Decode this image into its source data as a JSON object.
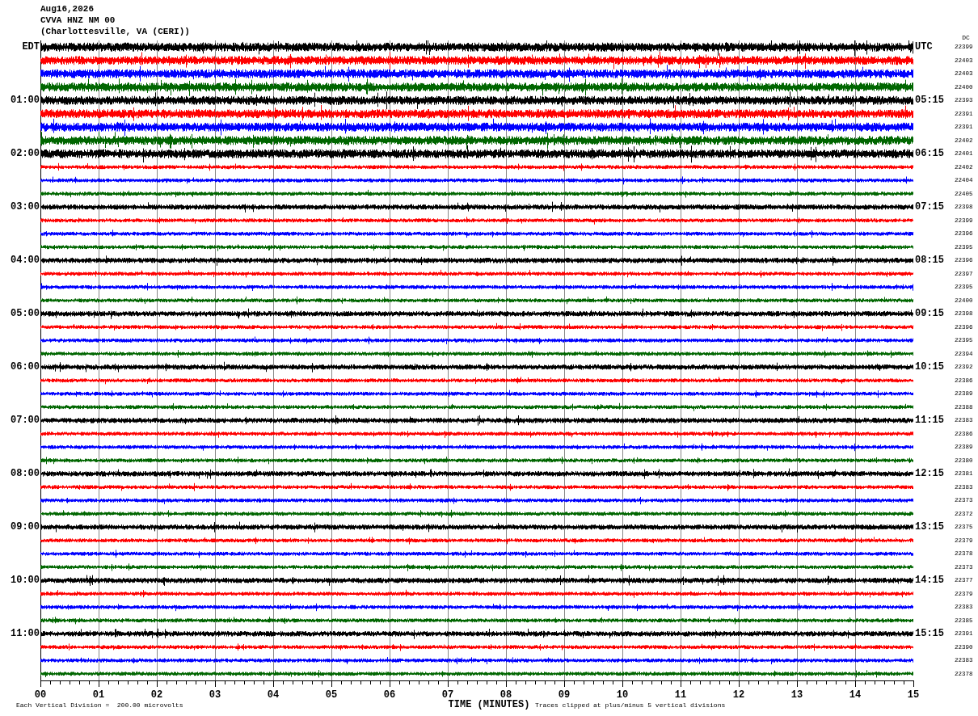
{
  "header": {
    "date": "Aug16,2026",
    "station": "CVVA HNZ NM 00",
    "location": "(Charlottesville, VA (CERI))"
  },
  "left_header": "EDT",
  "right_header": "UTC",
  "dc_header": "DC",
  "traces": [
    {
      "color": "#000000",
      "dc": "22399"
    },
    {
      "color": "#ff0000",
      "dc": "22403"
    },
    {
      "color": "#0000ff",
      "dc": "22403"
    },
    {
      "color": "#006600",
      "dc": "22400"
    },
    {
      "color": "#000000",
      "dc": "22393",
      "edt": "01:00",
      "utc": "05:15"
    },
    {
      "color": "#ff0000",
      "dc": "22391"
    },
    {
      "color": "#0000ff",
      "dc": "22391"
    },
    {
      "color": "#006600",
      "dc": "22402"
    },
    {
      "color": "#000000",
      "dc": "22401",
      "edt": "02:00",
      "utc": "06:15"
    },
    {
      "color": "#ff0000",
      "dc": "22402"
    },
    {
      "color": "#0000ff",
      "dc": "22404"
    },
    {
      "color": "#006600",
      "dc": "22405"
    },
    {
      "color": "#000000",
      "dc": "22398",
      "edt": "03:00",
      "utc": "07:15"
    },
    {
      "color": "#ff0000",
      "dc": "22399"
    },
    {
      "color": "#0000ff",
      "dc": "22396"
    },
    {
      "color": "#006600",
      "dc": "22395"
    },
    {
      "color": "#000000",
      "dc": "22396",
      "edt": "04:00",
      "utc": "08:15"
    },
    {
      "color": "#ff0000",
      "dc": "22397"
    },
    {
      "color": "#0000ff",
      "dc": "22395"
    },
    {
      "color": "#006600",
      "dc": "22400"
    },
    {
      "color": "#000000",
      "dc": "22398",
      "edt": "05:00",
      "utc": "09:15"
    },
    {
      "color": "#ff0000",
      "dc": "22396"
    },
    {
      "color": "#0000ff",
      "dc": "22395"
    },
    {
      "color": "#006600",
      "dc": "22394"
    },
    {
      "color": "#000000",
      "dc": "22392",
      "edt": "06:00",
      "utc": "10:15"
    },
    {
      "color": "#ff0000",
      "dc": "22386"
    },
    {
      "color": "#0000ff",
      "dc": "22389"
    },
    {
      "color": "#006600",
      "dc": "22388"
    },
    {
      "color": "#000000",
      "dc": "22383",
      "edt": "07:00",
      "utc": "11:15"
    },
    {
      "color": "#ff0000",
      "dc": "22386"
    },
    {
      "color": "#0000ff",
      "dc": "22389"
    },
    {
      "color": "#006600",
      "dc": "22380"
    },
    {
      "color": "#000000",
      "dc": "22381",
      "edt": "08:00",
      "utc": "12:15"
    },
    {
      "color": "#ff0000",
      "dc": "22383"
    },
    {
      "color": "#0000ff",
      "dc": "22373"
    },
    {
      "color": "#006600",
      "dc": "22372"
    },
    {
      "color": "#000000",
      "dc": "22375",
      "edt": "09:00",
      "utc": "13:15"
    },
    {
      "color": "#ff0000",
      "dc": "22379"
    },
    {
      "color": "#0000ff",
      "dc": "22378"
    },
    {
      "color": "#006600",
      "dc": "22373"
    },
    {
      "color": "#000000",
      "dc": "22377",
      "edt": "10:00",
      "utc": "14:15"
    },
    {
      "color": "#ff0000",
      "dc": "22379"
    },
    {
      "color": "#0000ff",
      "dc": "22383"
    },
    {
      "color": "#006600",
      "dc": "22385"
    },
    {
      "color": "#000000",
      "dc": "22391",
      "edt": "11:00",
      "utc": "15:15"
    },
    {
      "color": "#ff0000",
      "dc": "22390"
    },
    {
      "color": "#0000ff",
      "dc": "22383"
    },
    {
      "color": "#006600",
      "dc": "22378"
    }
  ],
  "x_axis": {
    "ticks": [
      "00",
      "01",
      "02",
      "03",
      "04",
      "05",
      "06",
      "07",
      "08",
      "09",
      "10",
      "11",
      "12",
      "13",
      "14",
      "15"
    ],
    "title": "TIME (MINUTES)"
  },
  "footer": {
    "scale": "Each Vertical Division =  200.00 microvolts",
    "clip": "Traces clipped at plus/minus 5 vertical divisions"
  }
}
